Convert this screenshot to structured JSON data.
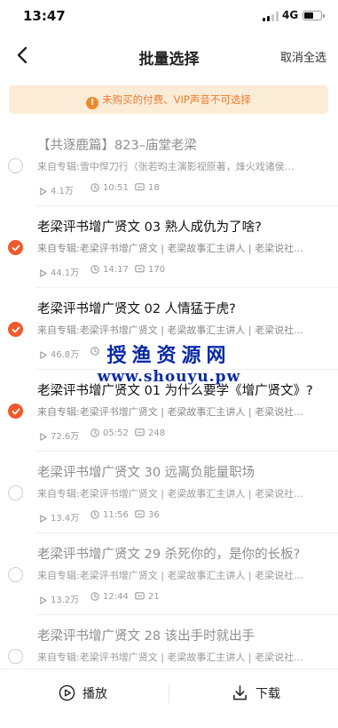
{
  "status_bar": {
    "time": "13:47",
    "network": "4G",
    "battery_level": 0.55
  },
  "nav": {
    "title": "批量选择",
    "right_action": "取消全选"
  },
  "notice": {
    "icon": "exclamation-icon",
    "text": "未购买的付费、VIP声音不可选择"
  },
  "items": [
    {
      "title": "【共逐鹿篇】823–庙堂老梁",
      "album": "来自专辑:雪中悍刀行（张若昀主演影视原著，烽火戏诸侯…",
      "plays": "4.1万",
      "duration": "10:51",
      "comments": "18",
      "checked": false,
      "selectable": false
    },
    {
      "title": "老梁评书增广贤文 03 熟人成仇为了啥?",
      "album": "来自专辑:老梁评书增广贤文 | 老梁故事汇主讲人 | 老梁说社…",
      "plays": "44.1万",
      "duration": "14:17",
      "comments": "170",
      "checked": true,
      "selectable": true
    },
    {
      "title": "老梁评书增广贤文 02 人情猛于虎?",
      "album": "来自专辑:老梁评书增广贤文 | 老梁故事汇主讲人 | 老梁说社…",
      "plays": "46.8万",
      "duration": "",
      "comments": "",
      "checked": true,
      "selectable": true
    },
    {
      "title": "老梁评书增广贤文 01 为什么要学《增广贤文》?",
      "album": "来自专辑:老梁评书增广贤文 | 老梁故事汇主讲人 | 老梁说社…",
      "plays": "72.6万",
      "duration": "05:52",
      "comments": "248",
      "checked": true,
      "selectable": true
    },
    {
      "title": "老梁评书增广贤文 30 远离负能量职场",
      "album": "来自专辑:老梁评书增广贤文 | 老梁故事汇主讲人 | 老梁说社…",
      "plays": "13.4万",
      "duration": "11:56",
      "comments": "36",
      "checked": false,
      "selectable": false
    },
    {
      "title": "老梁评书增广贤文 29 杀死你的，是你的长板?",
      "album": "来自专辑:老梁评书增广贤文 | 老梁故事汇主讲人 | 老梁说社…",
      "plays": "13.2万",
      "duration": "12:44",
      "comments": "21",
      "checked": false,
      "selectable": false
    },
    {
      "title": "老梁评书增广贤文 28 该出手时就出手",
      "album": "来自专辑:老梁评书增广贤文 | 老梁故事汇主讲人 | 老梁说社…",
      "plays": "",
      "duration": "",
      "comments": "",
      "checked": false,
      "selectable": false
    }
  ],
  "watermark": {
    "name": "授渔资源网",
    "url": "www.shouyu.pw"
  },
  "bottom_bar": {
    "play_label": "播放",
    "download_label": "下载"
  },
  "colors": {
    "accent": "#f0592c",
    "notice_bg": "#fbecd8",
    "notice_text": "#ee7a2c",
    "watermark": "#0a2aa8"
  }
}
